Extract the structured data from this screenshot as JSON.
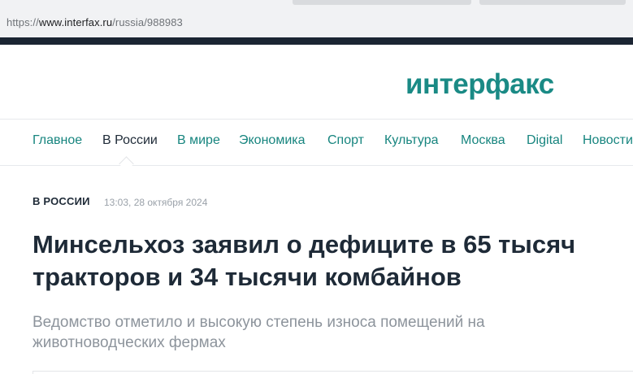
{
  "browser": {
    "url_scheme": "https://",
    "url_host": "www.interfax.ru",
    "url_path": "/russia/988983"
  },
  "header": {
    "logo_text": "интерфакс",
    "brand_color": "#1a8a85",
    "dark_color": "#1b2533"
  },
  "nav": {
    "items": [
      {
        "label": "Главное",
        "active": false
      },
      {
        "label": "В России",
        "active": true
      },
      {
        "label": "В мире",
        "active": false
      },
      {
        "label": "Экономика",
        "active": false
      },
      {
        "label": "Спорт",
        "active": false
      },
      {
        "label": "Культура",
        "active": false
      },
      {
        "label": "Москва",
        "active": false
      },
      {
        "label": "Digital",
        "active": false
      },
      {
        "label": "Новости",
        "active": false
      }
    ]
  },
  "article": {
    "rubric": "В РОССИИ",
    "timestamp": "13:03, 28 октября 2024",
    "headline": "Минсельхоз заявил о дефиците в 65 тысяч тракторов и 34 тысячи комбайнов",
    "lead": "Ведомство отметило и высокую степень износа помещений на животноводческих фермах"
  }
}
